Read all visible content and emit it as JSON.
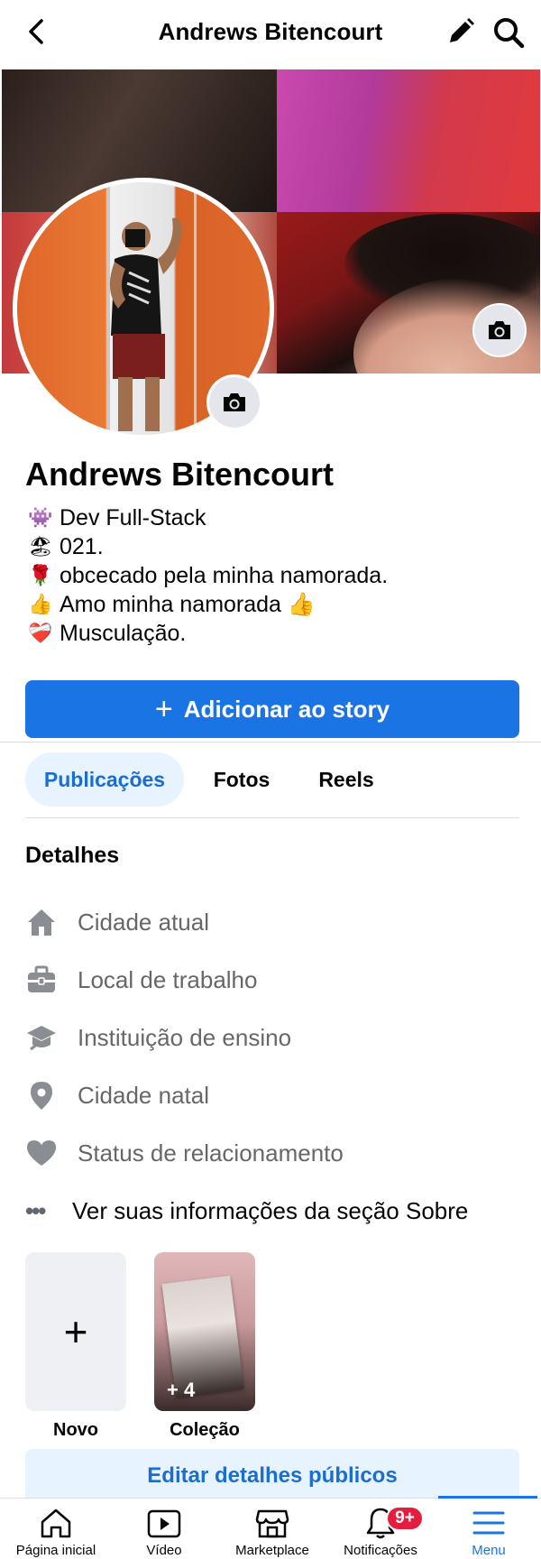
{
  "header": {
    "title": "Andrews Bitencourt",
    "back_icon": "chevron-left-icon",
    "edit_icon": "pencil-icon",
    "search_icon": "search-icon"
  },
  "profile": {
    "name": "Andrews Bitencourt",
    "bio": [
      {
        "emoji": "👾",
        "text": "Dev Full-Stack"
      },
      {
        "emoji": "🏖",
        "text": "021."
      },
      {
        "emoji": "🌹",
        "text": "obcecado pela minha namorada."
      },
      {
        "emoji": "👍",
        "text": "Amo minha namorada 👍"
      },
      {
        "emoji": "❤️‍🩹",
        "text": "Musculação."
      }
    ]
  },
  "actions": {
    "add_story": "Adicionar ao story",
    "add_story_plus": "+"
  },
  "tabs": [
    {
      "label": "Publicações",
      "active": true
    },
    {
      "label": "Fotos",
      "active": false
    },
    {
      "label": "Reels",
      "active": false
    }
  ],
  "details": {
    "title": "Detalhes",
    "items": [
      {
        "icon": "house-icon",
        "label": "Cidade atual"
      },
      {
        "icon": "briefcase-icon",
        "label": "Local de trabalho"
      },
      {
        "icon": "graduation-cap-icon",
        "label": "Instituição de ensino"
      },
      {
        "icon": "location-pin-icon",
        "label": "Cidade natal"
      },
      {
        "icon": "heart-icon",
        "label": "Status de relacionamento"
      }
    ],
    "about_link": "Ver suas informações da seção Sobre",
    "about_dots": "•••"
  },
  "featured": {
    "new_label": "Novo",
    "new_plus": "+",
    "collection_label": "Coleção",
    "collection_count": "+ 4"
  },
  "edit_public_details": "Editar detalhes públicos",
  "bottom_nav": [
    {
      "icon": "home-icon",
      "label": "Página inicial",
      "active": false
    },
    {
      "icon": "video-icon",
      "label": "Vídeo",
      "active": false
    },
    {
      "icon": "marketplace-icon",
      "label": "Marketplace",
      "active": false
    },
    {
      "icon": "bell-icon",
      "label": "Notificações",
      "active": false,
      "badge": "9+"
    },
    {
      "icon": "menu-icon",
      "label": "Menu",
      "active": true
    }
  ],
  "colors": {
    "accent": "#1b74e4",
    "tab_active_bg": "#e7f3ff",
    "badge": "#e41e3f",
    "icon_gray": "#8a8d91"
  }
}
